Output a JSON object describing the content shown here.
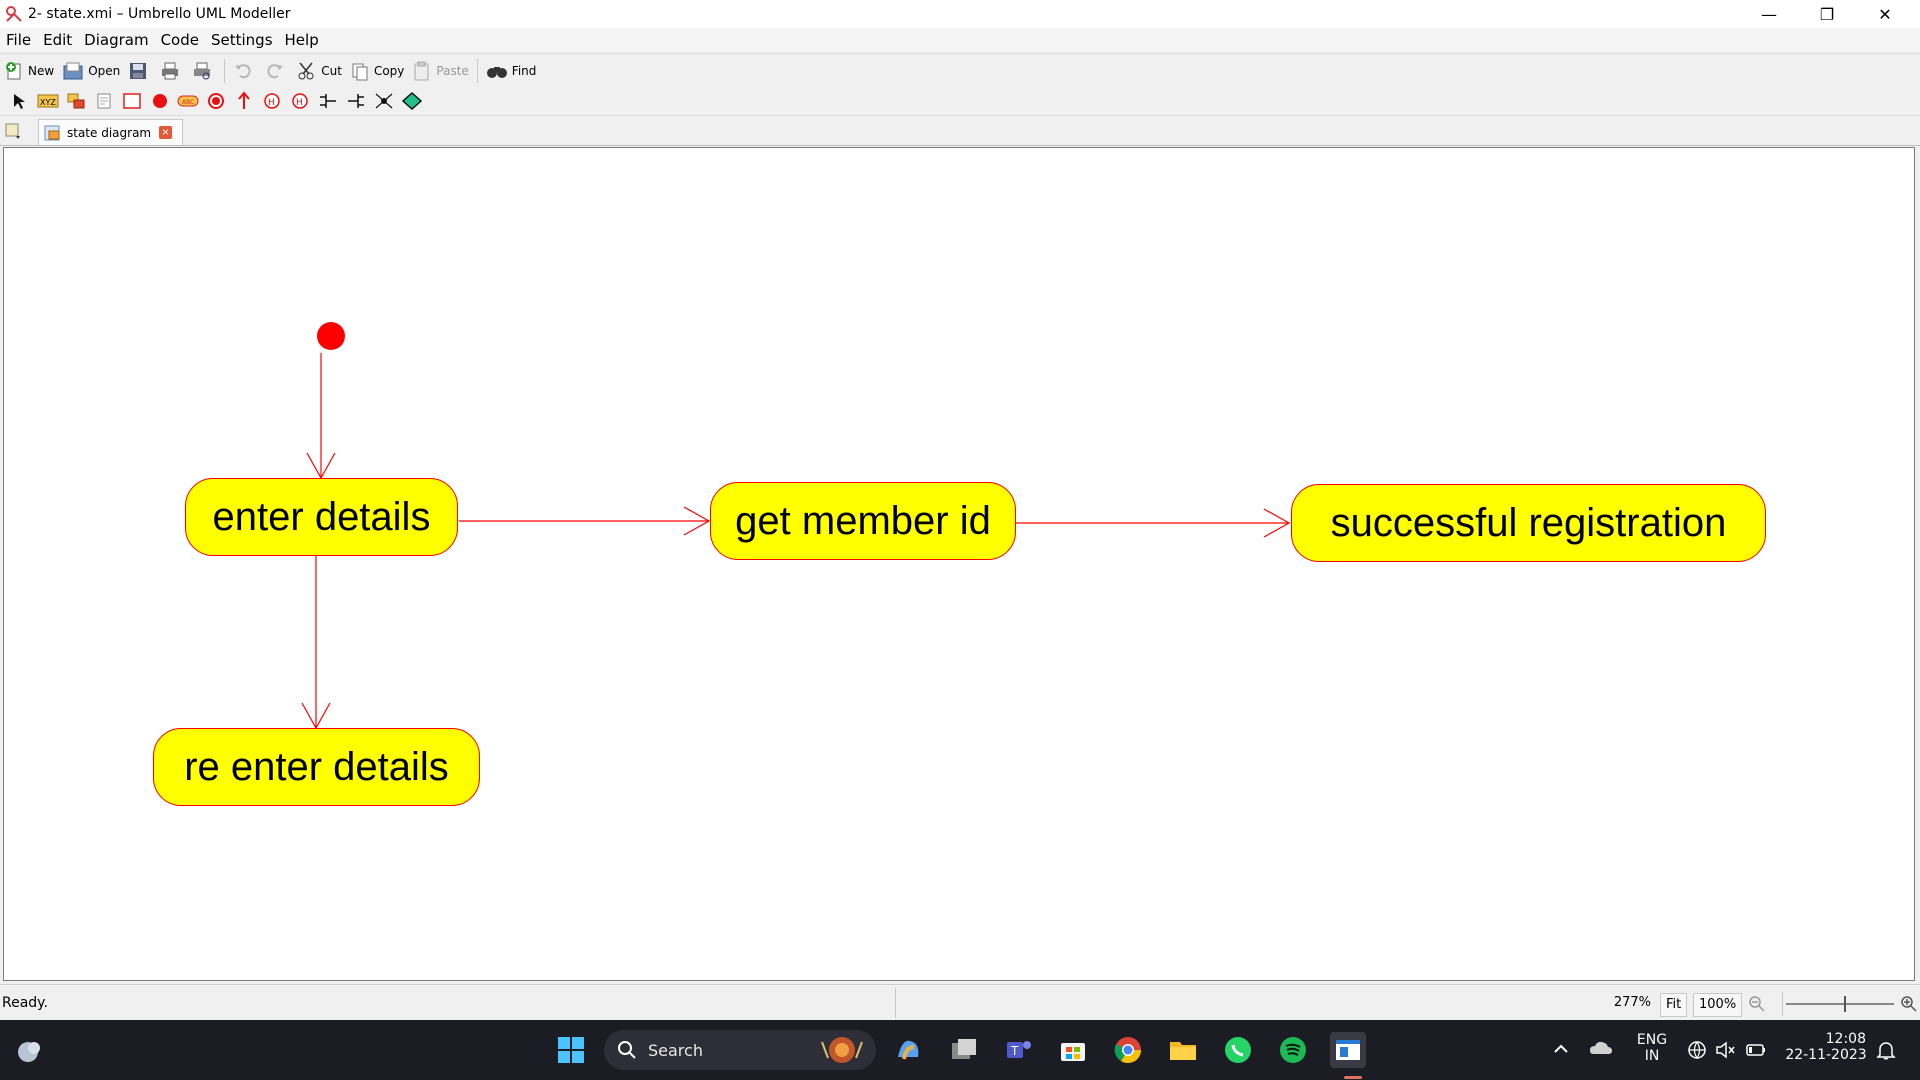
{
  "window": {
    "title": "2- state.xmi – Umbrello UML Modeller",
    "minimize_glyph": "—",
    "restore_glyph": "❐",
    "close_glyph": "✕"
  },
  "menu": [
    "File",
    "Edit",
    "Diagram",
    "Code",
    "Settings",
    "Help"
  ],
  "toolbar": {
    "new_label": "New",
    "open_label": "Open",
    "cut_label": "Cut",
    "copy_label": "Copy",
    "paste_label": "Paste",
    "find_label": "Find"
  },
  "tab": {
    "label": "state diagram",
    "close_glyph": "×"
  },
  "diagram": {
    "states": [
      {
        "label": "enter details"
      },
      {
        "label": "get member id"
      },
      {
        "label": "successful registration"
      },
      {
        "label": "re enter details"
      }
    ],
    "colors": {
      "state_fill": "#ffff00",
      "state_border": "#ff0000",
      "arrow": "#ff0000",
      "initial": "#ff0000"
    }
  },
  "status": {
    "text": "Ready.",
    "zoom": "277%",
    "fit_label": "Fit",
    "hundred_label": "100%"
  },
  "taskbar": {
    "search_placeholder": "Search",
    "lang": "ENG",
    "region": "IN",
    "time": "12:08",
    "date": "22-11-2023"
  }
}
